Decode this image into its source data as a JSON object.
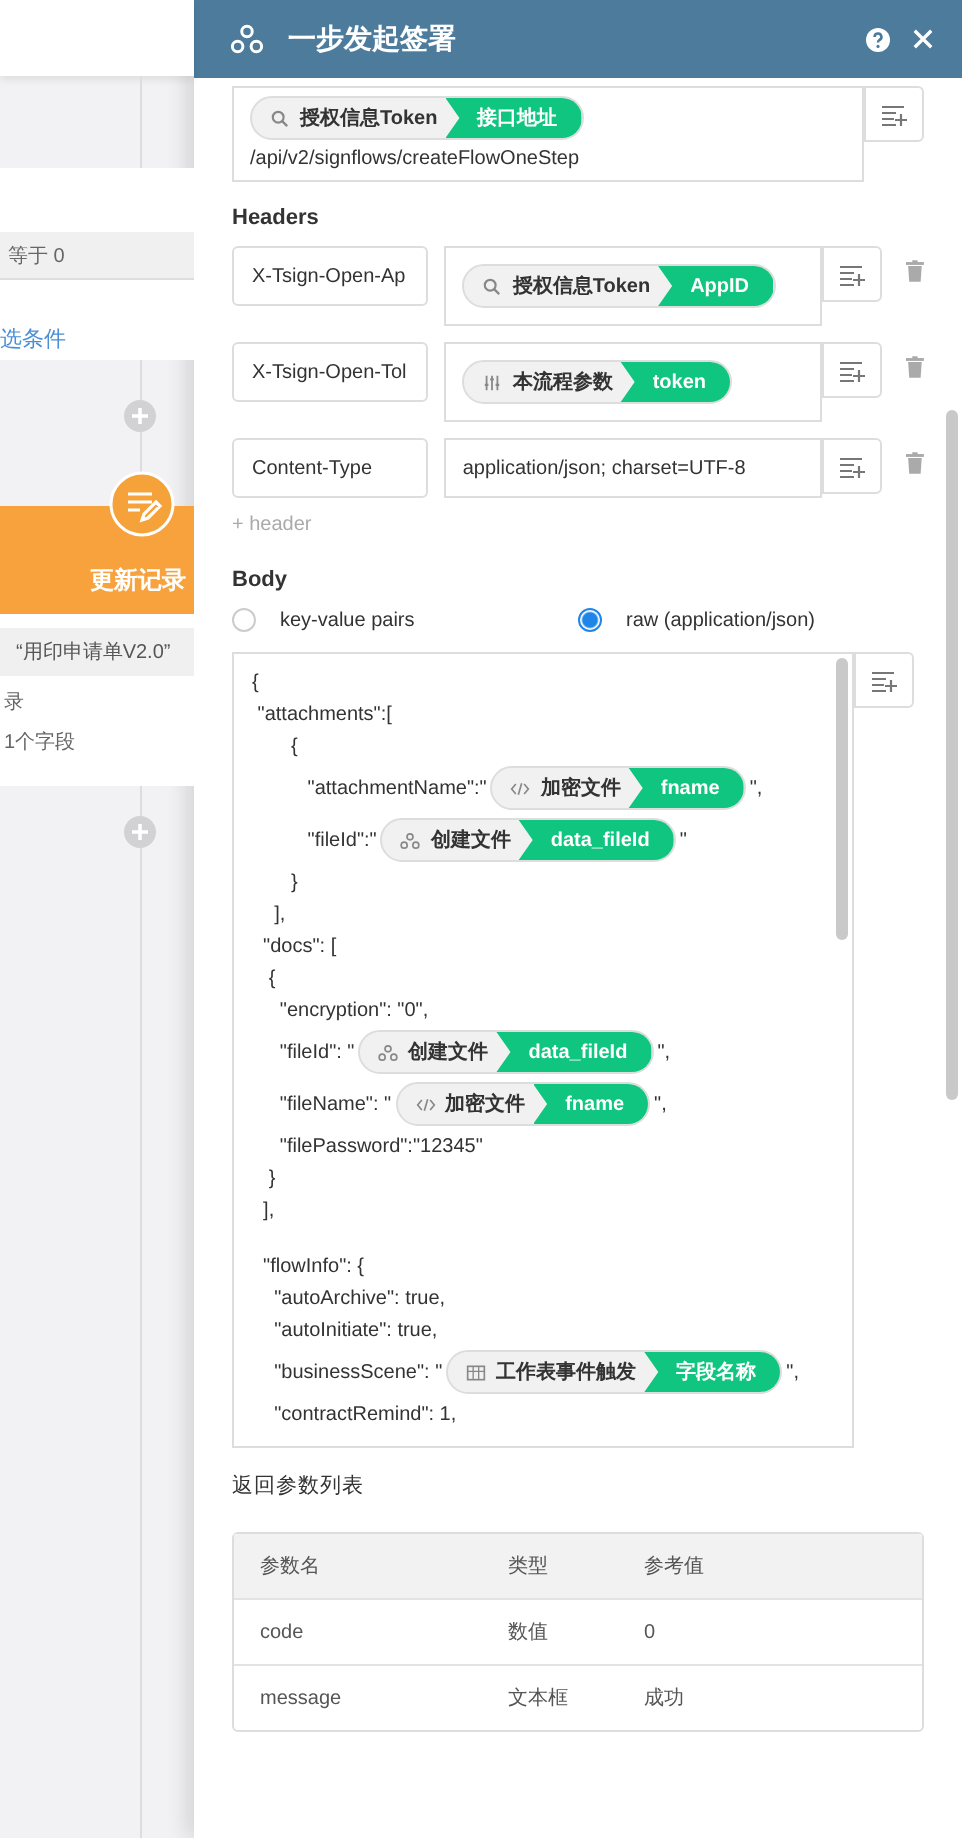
{
  "background": {
    "condition_value": "等于 0",
    "filter_link": "选条件",
    "action_title": "更新记录",
    "action_form": "“用印申请单V2.0”",
    "action_line_1": "录",
    "action_line_2": "1个字段"
  },
  "drawer": {
    "title": "一步发起签署"
  },
  "url_field": {
    "tag": {
      "kind": "search",
      "source": "授权信息Token",
      "field": "接口地址"
    },
    "value": "/api/v2/signflows/createFlowOneStep"
  },
  "headers": {
    "title": "Headers",
    "rows": [
      {
        "key": "X-Tsign-Open-Ap",
        "tag": {
          "kind": "search",
          "source": "授权信息Token",
          "field": "AppID"
        }
      },
      {
        "key": "X-Tsign-Open-Tol",
        "tag": {
          "kind": "sliders",
          "source": "本流程参数",
          "field": "token"
        }
      },
      {
        "key": "Content-Type",
        "text": "application/json; charset=UTF-8"
      }
    ],
    "add_label": "+ header"
  },
  "body": {
    "title": "Body",
    "modes": [
      {
        "label": "key-value pairs",
        "selected": false
      },
      {
        "label": "raw (application/json)",
        "selected": true
      }
    ],
    "lines": [
      [
        {
          "kind": "text",
          "text": "{"
        }
      ],
      [
        {
          "kind": "text",
          "text": " \"attachments\":["
        }
      ],
      [
        {
          "kind": "text",
          "text": "       {"
        }
      ],
      [
        {
          "kind": "text",
          "text": "          \"attachmentName\":\""
        },
        {
          "kind": "tag",
          "tag": {
            "kind": "code",
            "source": "加密文件",
            "field": "fname"
          }
        },
        {
          "kind": "text",
          "text": "\","
        }
      ],
      [
        {
          "kind": "text",
          "text": "          \"fileId\":\""
        },
        {
          "kind": "tag",
          "tag": {
            "kind": "nodes",
            "source": "创建文件",
            "field": "data_fileId"
          }
        },
        {
          "kind": "text",
          "text": "\""
        }
      ],
      [
        {
          "kind": "text",
          "text": "       }"
        }
      ],
      [
        {
          "kind": "text",
          "text": "    ],"
        }
      ],
      [
        {
          "kind": "text",
          "text": "  \"docs\": ["
        }
      ],
      [
        {
          "kind": "text",
          "text": "   {"
        }
      ],
      [
        {
          "kind": "text",
          "text": "     \"encryption\": \"0\","
        }
      ],
      [
        {
          "kind": "text",
          "text": "     \"fileId\": \""
        },
        {
          "kind": "tag",
          "tag": {
            "kind": "nodes",
            "source": "创建文件",
            "field": "data_fileId"
          }
        },
        {
          "kind": "text",
          "text": "\","
        }
      ],
      [
        {
          "kind": "text",
          "text": "     \"fileName\": \""
        },
        {
          "kind": "tag",
          "tag": {
            "kind": "code",
            "source": "加密文件",
            "field": "fname"
          }
        },
        {
          "kind": "text",
          "text": "\","
        }
      ],
      [
        {
          "kind": "text",
          "text": "     \"filePassword\":\"12345\""
        }
      ],
      [
        {
          "kind": "text",
          "text": "   }"
        }
      ],
      [
        {
          "kind": "text",
          "text": "  ],"
        }
      ],
      [
        {
          "kind": "blank"
        }
      ],
      [
        {
          "kind": "text",
          "text": "  \"flowInfo\": {"
        }
      ],
      [
        {
          "kind": "text",
          "text": "    \"autoArchive\": true,"
        }
      ],
      [
        {
          "kind": "text",
          "text": "    \"autoInitiate\": true,"
        }
      ],
      [
        {
          "kind": "text",
          "text": "    \"businessScene\": \""
        },
        {
          "kind": "tag",
          "tag": {
            "kind": "table",
            "source": "工作表事件触发",
            "field": "字段名称"
          }
        },
        {
          "kind": "text",
          "text": "\","
        }
      ],
      [
        {
          "kind": "text",
          "text": "    \"contractRemind\": 1,"
        }
      ]
    ]
  },
  "returns": {
    "title": "返回参数列表",
    "columns": [
      "参数名",
      "类型",
      "参考值"
    ],
    "rows": [
      [
        "code",
        "数值",
        "0"
      ],
      [
        "message",
        "文本框",
        "成功"
      ]
    ]
  }
}
